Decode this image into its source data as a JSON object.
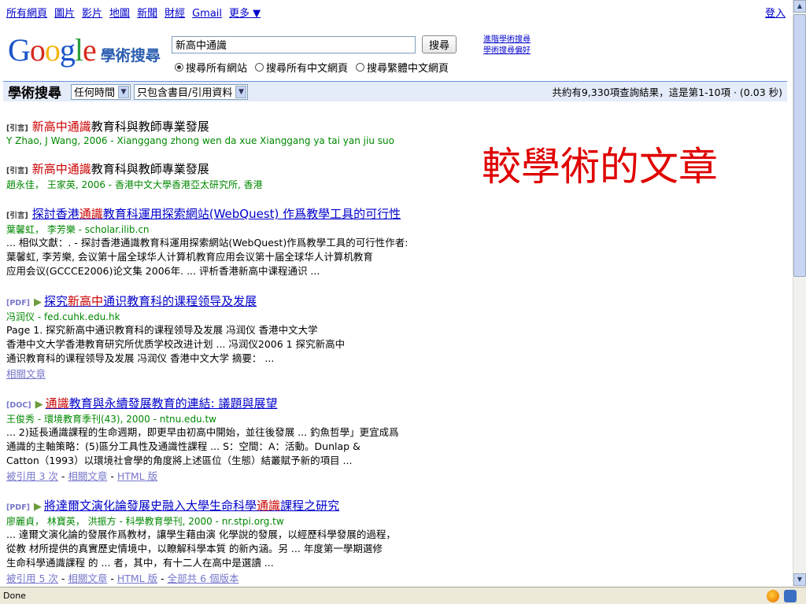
{
  "topnav": [
    "所有網頁",
    "圖片",
    "影片",
    "地圖",
    "新聞",
    "財經",
    "Gmail"
  ],
  "topnav_more": "更多",
  "signin": "登入",
  "logo": {
    "text": "Google",
    "sub": "學術搜尋"
  },
  "search": {
    "value": "新高中通識",
    "button": "搜尋"
  },
  "advanced": [
    "進階學術搜尋",
    "學術搜尋偏好"
  ],
  "radios": [
    {
      "label": "搜尋所有網站",
      "checked": true
    },
    {
      "label": "搜尋所有中文網頁",
      "checked": false
    },
    {
      "label": "搜尋繁體中文網頁",
      "checked": false
    }
  ],
  "bar": {
    "title": "學術搜尋",
    "time_select": "任何時間",
    "type_select": "只包含書目/引用資料",
    "stats": "共約有9,330項查詢結果，這是第1-10項 · (0.03 秒)"
  },
  "annotation": "較學術的文章",
  "results": [
    {
      "tag": "[引言]",
      "title_pre": "",
      "title_red": "新高中通識",
      "title_post": "教育科與教師專業發展",
      "link": false,
      "authors": "Y Zhao, J Wang, 2006 - Xianggang zhong wen da xue Xianggang ya tai yan jiu suo",
      "snippet": [],
      "footer": []
    },
    {
      "tag": "[引言]",
      "title_pre": "",
      "title_red": "新高中通識",
      "title_post": "教育科與教師專業發展",
      "link": false,
      "authors": "趙永佳， 王家英, 2006 - 香港中文大學香港亞太研究所, 香港",
      "snippet": [],
      "footer": []
    },
    {
      "tag": "[引言]",
      "title_pre": "探討香港",
      "title_red": "通識",
      "title_post": "教育科運用探索網站(WebQuest) 作爲教學工具的可行性",
      "link": true,
      "authors": "葉馨虹， 李芳樂 - scholar.ilib.cn",
      "snippet": [
        "... 相似文獻：. - 探討香港通識教育科運用探索網站(WebQuest)作爲教學工具的可行性作者:",
        "葉馨虹, 李芳樂, 会议第十届全球华人计算机教育应用会议第十届全球华人计算机教育",
        "应用会议(GCCCE2006)论文集 2006年. ... 评析香港新高中课程通识 ..."
      ],
      "footer": []
    },
    {
      "tag": "[PDF]",
      "title_pre": "探究",
      "title_red": "新高中",
      "title_post": "通识教育科的课程领导及发展",
      "link": true,
      "authors": "冯润仪 - fed.cuhk.edu.hk",
      "snippet": [
        "Page 1. 探究新高中通识教育科的课程领导及发展 冯润仪 香港中文大学",
        "香港中文大学香港教育研究所优质学校改进计划 ... 冯润仪2006 1 探究新高中",
        "通识教育科的课程领导及发展 冯润仪 香港中文大学 摘要： ..."
      ],
      "footer": [
        "相關文章"
      ]
    },
    {
      "tag": "[DOC]",
      "title_pre": "",
      "title_red": "通識",
      "title_post": "教育與永續發展教育的連結: 議題與展望",
      "link": true,
      "authors": "王俊秀 - 環境教育季刊(43), 2000 - ntnu.edu.tw",
      "snippet": [
        "... 2)延長通識課程的生命週期，即更早由初高中開始，並往後發展 ... 釣魚哲學」更宜成爲",
        "通識的主軸策略：(5)區分工具性及通識性課程 ... S：空間：A：活動。Dunlap &",
        "Catton（1993）以環境社會學的角度將上述區位（生態）結叢賦予新的項目 ..."
      ],
      "footer": [
        "被引用 3 次",
        "相關文章",
        "HTML 版"
      ]
    },
    {
      "tag": "[PDF]",
      "title_pre": "將達爾文演化論發展史融入大學生命科學",
      "title_red": "通識",
      "title_post": "課程之研究",
      "link": true,
      "authors": "廖麗貞， 林寶英， 洪振方 - 科學教育學刊, 2000 - nr.stpi.org.tw",
      "snippet": [
        "... 達爾文演化論的發展作爲教材，讓學生藉由演 化學說的發展，以經歷科學發展的過程，",
        "從教 材所提供的真實歷史情境中，以瞭解科學本質 的新內涵。另 ... 年度第一學期選修",
        "生命科學通識課程 的 ... 者，其中，有十二人在高中是選讀 ..."
      ],
      "footer": [
        "被引用 5 次",
        "相關文章",
        "HTML 版",
        "全部共 6 個版本"
      ]
    }
  ],
  "status": "Done"
}
